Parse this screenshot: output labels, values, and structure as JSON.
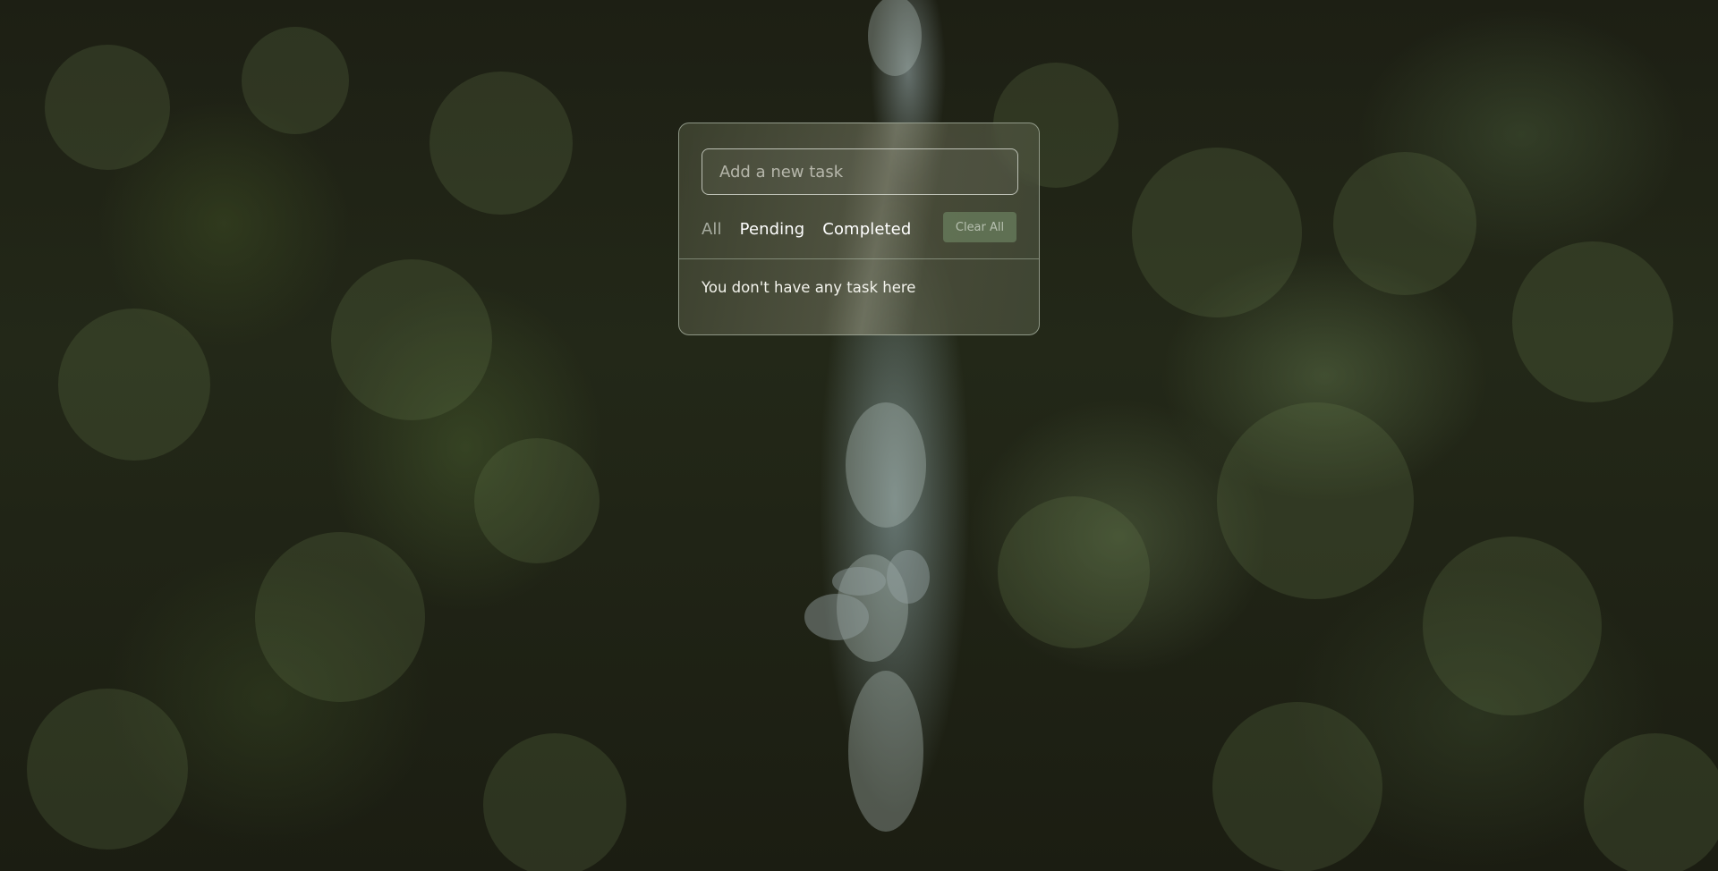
{
  "app": {
    "input": {
      "placeholder": "Add a new task",
      "value": ""
    },
    "filters": [
      {
        "label": "All",
        "active": true
      },
      {
        "label": "Pending",
        "active": false
      },
      {
        "label": "Completed",
        "active": false
      }
    ],
    "clear_label": "Clear All",
    "empty_message": "You don't have any task here"
  },
  "colors": {
    "accent_button": "#6e8764",
    "card_border": "#d2dccd"
  }
}
